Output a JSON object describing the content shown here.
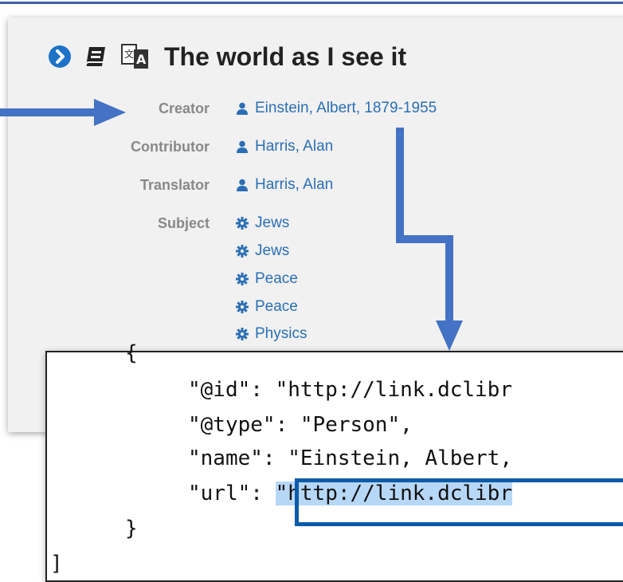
{
  "record": {
    "title": "The world as I see it",
    "fields": [
      {
        "label": "Creator",
        "values": [
          "Einstein, Albert, 1879-1955"
        ],
        "icon": "person-icon"
      },
      {
        "label": "Contributor",
        "values": [
          "Harris, Alan"
        ],
        "icon": "person-icon"
      },
      {
        "label": "Translator",
        "values": [
          "Harris, Alan"
        ],
        "icon": "person-icon"
      },
      {
        "label": "Subject",
        "values": [
          "Jews",
          "Jews",
          "Peace",
          "Peace",
          "Physics"
        ],
        "icon": "gear-icon"
      }
    ]
  },
  "code": {
    "brace_top": "{",
    "id_line": "\"@id\": \"http://link.dclibr",
    "type_line": "\"@type\": \"Person\",",
    "name_line": "\"name\": \"Einstein, Albert,",
    "url_key": "\"url\": ",
    "url_value": "\"http://link.dclibr",
    "brace_close": "}",
    "brace_outer": "]"
  },
  "colors": {
    "link": "#2a6fb5",
    "arrow": "#4472c4",
    "highlight": "#b7d7f7",
    "highlight_border": "#0c5ba8"
  }
}
